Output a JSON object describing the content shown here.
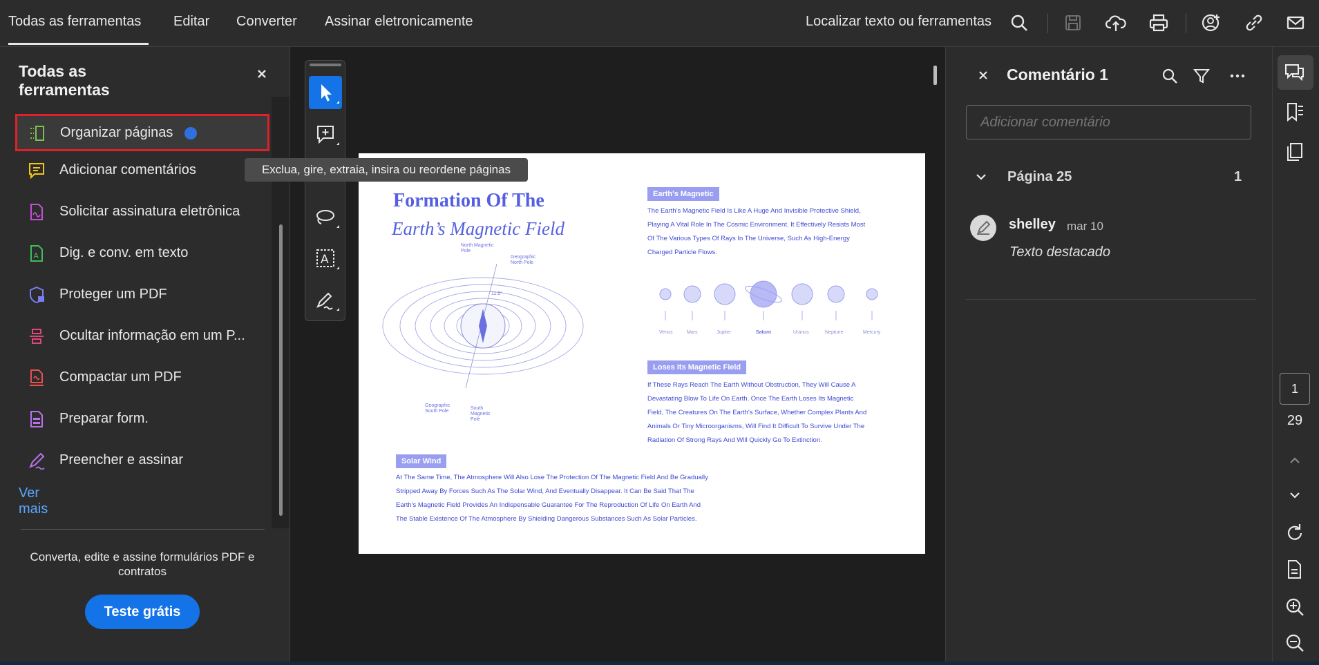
{
  "topbar": {
    "menus": [
      "Todas as ferramentas",
      "Editar",
      "Converter",
      "Assinar eletronicamente"
    ],
    "search_label": "Localizar texto ou ferramentas",
    "icons": [
      "search-icon",
      "save-icon",
      "cloud-upload-icon",
      "print-icon",
      "share-user-icon",
      "link-icon",
      "mail-icon"
    ]
  },
  "left_panel": {
    "title": "Todas as ferramentas",
    "tools": [
      {
        "label": "Organizar páginas",
        "icon": "organize-pages-icon",
        "color": "#7cc24a"
      },
      {
        "label": "Adicionar comentários",
        "icon": "add-comment-icon",
        "color": "#f5c518"
      },
      {
        "label": "Solicitar assinatura eletrônica",
        "icon": "request-signature-icon",
        "color": "#c64fd9"
      },
      {
        "label": "Dig. e conv. em texto",
        "icon": "scan-ocr-icon",
        "color": "#3ebd5a"
      },
      {
        "label": "Proteger um PDF",
        "icon": "protect-pdf-icon",
        "color": "#7a7ef2"
      },
      {
        "label": "Ocultar informação em um P...",
        "icon": "redact-icon",
        "color": "#e2467a"
      },
      {
        "label": "Compactar um PDF",
        "icon": "compress-pdf-icon",
        "color": "#e85050"
      },
      {
        "label": "Preparar form.",
        "icon": "prepare-form-icon",
        "color": "#b772e8"
      },
      {
        "label": "Preencher e assinar",
        "icon": "fill-sign-icon",
        "color": "#b772e8"
      }
    ],
    "see_more": "Ver mais",
    "promo_text": "Converta, edite e assine formulários PDF e contratos",
    "trial_button": "Teste grátis"
  },
  "tooltip": "Exclua, gire, extraia, insira ou reordene páginas",
  "document_page": {
    "title_line1": "Formation Of The",
    "title_line2": "Earth’s Magnetic Field",
    "diagram_labels": [
      "North Magnetic Pole",
      "Geographic North Pole",
      "Geographic South Pole",
      "South Magnetic Pole",
      "11.5°"
    ],
    "section1_tag": "Earth's Magnetic",
    "section1_text": "The Earth's Magnetic Field Is Like A Huge And Invisible Protective Shield,\nPlaying A Vital Role In The Cosmic Environment. It Effectively Resists Most\nOf The Various Types Of Rays In The Universe, Such As High-Energy\nCharged Particle Flows.",
    "planets": [
      "Venus",
      "Mars",
      "Jupiter",
      "Saturn",
      "Uranus",
      "Neptune",
      "Mercury"
    ],
    "section2_tag": "Loses Its Magnetic Field",
    "section2_text": "If These Rays Reach The Earth Without Obstruction, They Will Cause A\nDevastating Blow To Life On Earth. Once The Earth Loses Its Magnetic\nField, The Creatures On The Earth's Surface, Whether Complex Plants And\nAnimals Or Tiny Microorganisms, Will Find It Difficult To Survive Under The\nRadiation Of Strong Rays And Will Quickly Go To Extinction.",
    "section3_tag": "Solar Wind",
    "section3_text": "At The Same Time, The Atmosphere Will Also Lose The Protection Of The Magnetic Field And Be Gradually\nStripped Away By Forces Such As The Solar Wind, And Eventually Disappear. It Can Be Said That The\nEarth's Magnetic Field Provides An Indispensable Guarantee For The Reproduction Of Life On Earth And\nThe Stable Existence Of The Atmosphere By Shielding Dangerous Substances Such As Solar Particles."
  },
  "comments_panel": {
    "title": "Comentário 1",
    "input_placeholder": "Adicionar comentário",
    "page_group": "Página 25",
    "page_count": "1",
    "comment": {
      "author": "shelley",
      "date": "mar 10",
      "text": "Texto destacado"
    }
  },
  "right_rail": {
    "current_page": "1",
    "total_pages": "29"
  },
  "colors": {
    "accent": "#1473e6",
    "highlight_border": "#e0202a",
    "link": "#58a6ff",
    "page_text": "#3e4ad0"
  }
}
